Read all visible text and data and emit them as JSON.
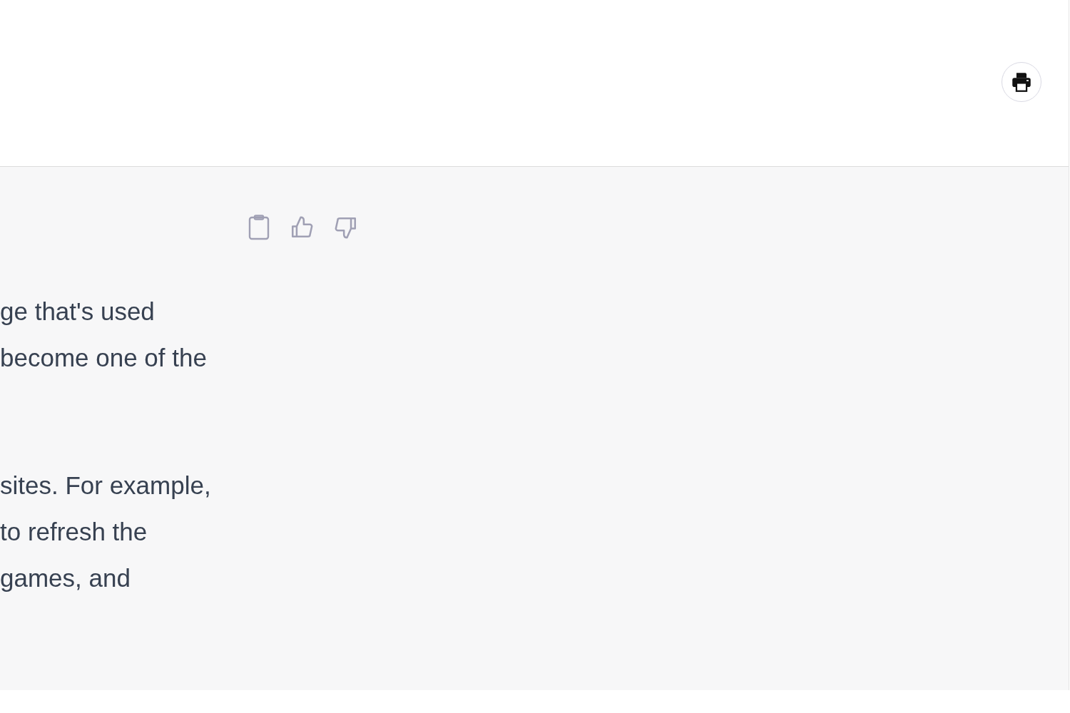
{
  "header": {
    "buttons": [
      {
        "kind": "print"
      }
    ]
  },
  "message": {
    "actions": [
      {
        "kind": "copy"
      },
      {
        "kind": "thumbs_up"
      },
      {
        "kind": "thumbs_down"
      }
    ],
    "paragraphs": [
      [
        "ge that's used",
        "become one of the"
      ],
      [
        "sites. For example,",
        "to refresh the",
        "games, and"
      ]
    ]
  }
}
